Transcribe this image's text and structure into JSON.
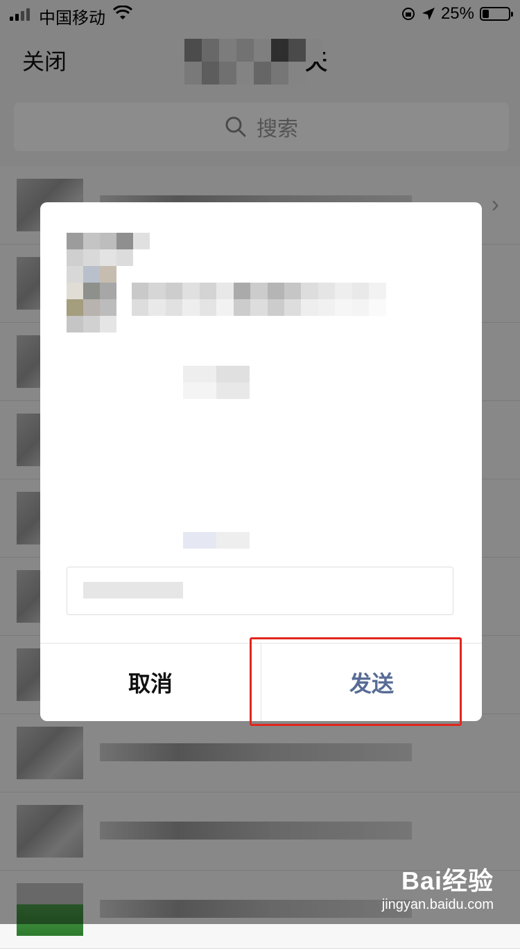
{
  "status_bar": {
    "carrier": "中国移动",
    "battery": "25%",
    "battery_level": 0.25
  },
  "nav": {
    "close_label": "关闭",
    "title_prefix": "选",
    "title_suffix": "天"
  },
  "search": {
    "placeholder": "搜索"
  },
  "dialog": {
    "cancel_label": "取消",
    "send_label": "发送"
  },
  "watermark": {
    "logo": "Bai经验",
    "url": "jingyan.baidu.com"
  },
  "colors": {
    "send": "#576b95",
    "highlight": "#e0261d",
    "overlay": "rgba(0,0,0,0.45)"
  },
  "icons": [
    "signal-icon",
    "wifi-icon",
    "rotation-lock-icon",
    "location-arrow-icon",
    "battery-icon",
    "search-icon",
    "chevron-right-icon"
  ]
}
